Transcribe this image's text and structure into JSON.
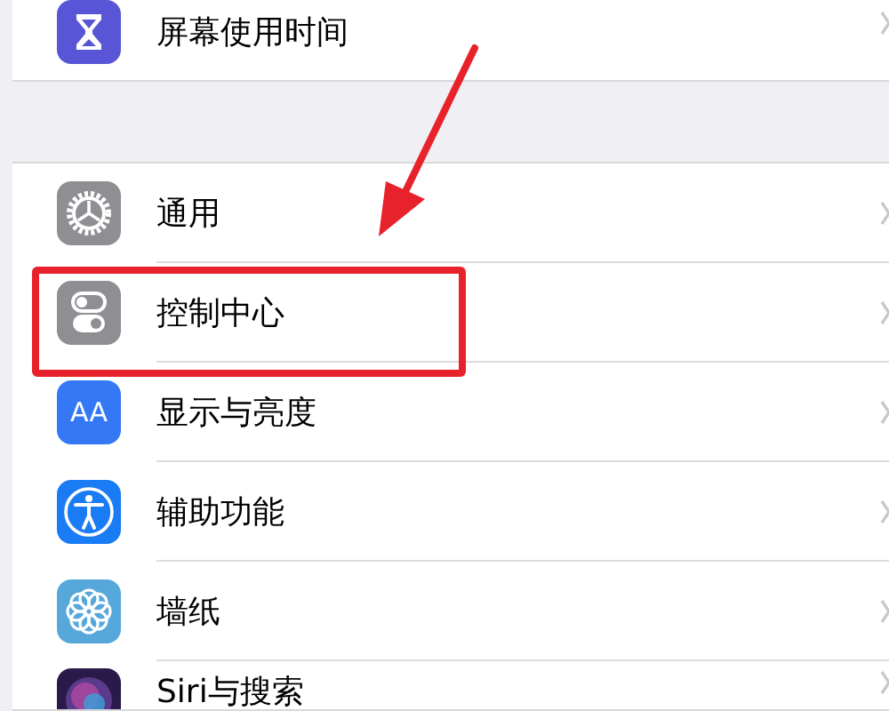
{
  "groups": [
    {
      "rows": [
        {
          "label": "屏幕使用时间",
          "kind": "hourglass",
          "color": "#5856d6",
          "highlighted": false
        }
      ]
    },
    {
      "rows": [
        {
          "label": "通用",
          "kind": "gear",
          "color": "#8e8e93",
          "highlighted": false
        },
        {
          "label": "控制中心",
          "kind": "toggles",
          "color": "#8e8e93",
          "highlighted": true
        },
        {
          "label": "显示与亮度",
          "kind": "letters",
          "icon_text": "AA",
          "color": "#3478f6",
          "highlighted": false
        },
        {
          "label": "辅助功能",
          "kind": "accessibility",
          "color": "#1a7cf5",
          "highlighted": false
        },
        {
          "label": "墙纸",
          "kind": "flower",
          "color": "#56a8db",
          "highlighted": false
        },
        {
          "label": "Siri与搜索",
          "kind": "siri",
          "color": "#2a1a4a",
          "highlighted": false
        }
      ]
    }
  ]
}
